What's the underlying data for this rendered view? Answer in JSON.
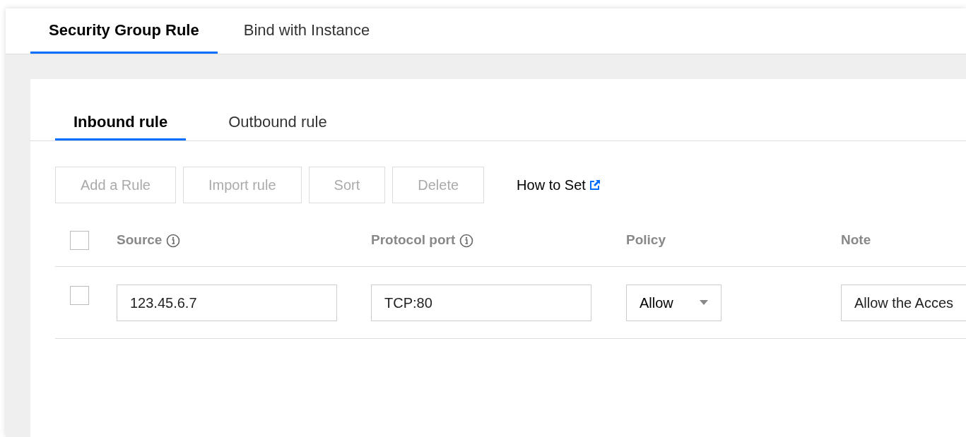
{
  "tabs": [
    {
      "label": "Security Group Rule",
      "selected": true
    },
    {
      "label": "Bind with Instance",
      "selected": false
    }
  ],
  "sub_tabs": [
    {
      "label": "Inbound rule",
      "selected": true
    },
    {
      "label": "Outbound rule",
      "selected": false
    }
  ],
  "toolbar": {
    "buttons": [
      {
        "label": "Add a Rule",
        "disabled": true
      },
      {
        "label": "Import rule",
        "disabled": true
      },
      {
        "label": "Sort",
        "disabled": true
      },
      {
        "label": "Delete",
        "disabled": true
      }
    ],
    "help_link": "How to Set"
  },
  "table": {
    "select_all_checked": false,
    "columns": [
      {
        "label": "Source",
        "info": true
      },
      {
        "label": "Protocol port",
        "info": true
      },
      {
        "label": "Policy",
        "info": false
      },
      {
        "label": "Note",
        "info": false
      }
    ],
    "rows": [
      {
        "checked": false,
        "source": "123.45.6.7",
        "protocol_port": "TCP:80",
        "policy": "Allow",
        "note": "Allow the Acces"
      }
    ]
  }
}
